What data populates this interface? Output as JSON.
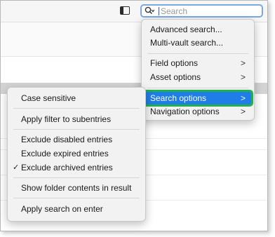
{
  "search": {
    "placeholder": "Search"
  },
  "options_menu": {
    "items": [
      {
        "label": "Advanced search..."
      },
      {
        "label": "Multi-vault search..."
      },
      {
        "label": "Field options"
      },
      {
        "label": "Asset options"
      },
      {
        "label": "Search options"
      },
      {
        "label": "Navigation options"
      }
    ],
    "submenu_glyph": ">",
    "highlight_color": "#1f7de8",
    "focus_outline_color": "#22b04a"
  },
  "search_options_menu": {
    "items": [
      {
        "label": "Case sensitive"
      },
      {
        "label": "Apply filter to subentries"
      },
      {
        "label": "Exclude disabled entries"
      },
      {
        "label": "Exclude expired entries"
      },
      {
        "label": "Exclude archived entries",
        "checked": true
      },
      {
        "label": "Show folder contents in result"
      },
      {
        "label": "Apply search on enter"
      }
    ],
    "check_glyph": "✓"
  },
  "icons": {
    "sidebar_toggle": "sidebar-toggle-icon",
    "search": "search-icon"
  }
}
